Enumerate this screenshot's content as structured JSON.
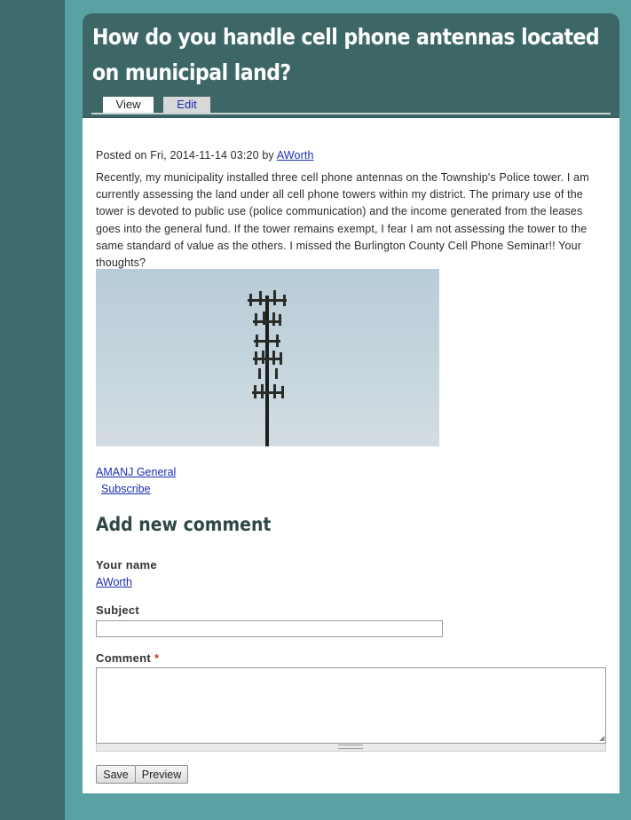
{
  "node": {
    "title": "How do you handle cell phone antennas located on municipal land?",
    "tabs": [
      {
        "label": "View",
        "active": true
      },
      {
        "label": "Edit",
        "active": false
      }
    ],
    "meta": {
      "prefix": "Posted on Fri, 2014-11-14 03:20 by ",
      "author": "AWorth"
    },
    "body": "Recently, my municipality installed three cell phone antennas on the Township's Police tower. I am currently assessing the land under all cell phone towers within my district. The primary use of the tower is devoted to public use (police communication) and the income generated from the leases goes into the general fund. If the tower remains exempt, I fear I am not assessing the tower to the same standard of value as the others. I missed the Burlington County Cell Phone Seminar!! Your thoughts?",
    "taxonomy_link": "AMANJ General",
    "subscribe_link": "Subscribe"
  },
  "comment_form": {
    "heading": "Add new comment",
    "your_name_label": "Your name",
    "your_name_value": "AWorth",
    "subject_label": "Subject",
    "subject_value": "",
    "comment_label": "Comment",
    "comment_required_marker": "*",
    "comment_value": "",
    "save_label": "Save",
    "preview_label": "Preview"
  },
  "colors": {
    "page_background": "#5aa1a4",
    "sidebar": "#3d6a6a",
    "header": "#3d6767",
    "link": "#1a2db0",
    "heading": "#2f4747"
  }
}
